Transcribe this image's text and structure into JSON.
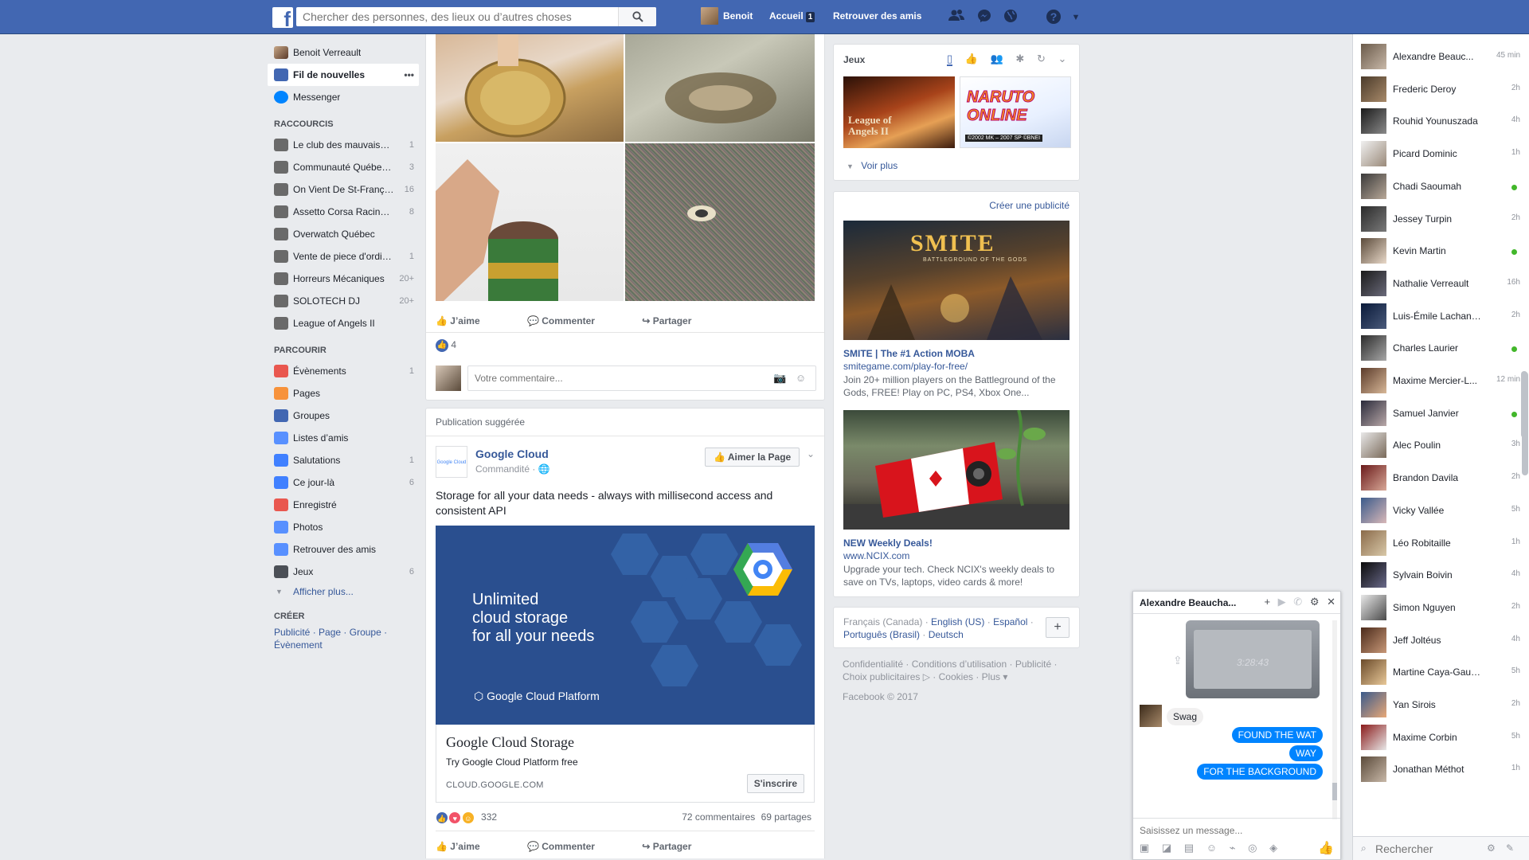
{
  "topbar": {
    "search_placeholder": "Chercher des personnes, des lieux ou d’autres choses",
    "user_name": "Benoit",
    "home": "Accueil",
    "home_badge": "1",
    "find_friends": "Retrouver des amis",
    "icons": [
      "friends-icon",
      "messenger-icon",
      "globe-icon",
      "help-icon"
    ]
  },
  "leftnav": {
    "profile": "Benoit Verreault",
    "main": [
      {
        "label": "Fil de nouvelles",
        "more": "•••",
        "color": "#4267b2"
      },
      {
        "label": "Messenger",
        "color": "#0084ff"
      }
    ],
    "shortcuts_head": "RACCOURCIS",
    "shortcuts": [
      {
        "label": "Le club des mauvais…",
        "count": "1",
        "icon": "skull-icon"
      },
      {
        "label": "Communauté Québe…",
        "count": "3",
        "icon": "gamepad-icon"
      },
      {
        "label": "On Vient De St-Franç…",
        "count": "16",
        "icon": "group-icon"
      },
      {
        "label": "Assetto Corsa Racin…",
        "count": "8",
        "icon": "gamepad-icon"
      },
      {
        "label": "Overwatch Québec",
        "count": "",
        "icon": "gamepad-icon"
      },
      {
        "label": "Vente de piece d'ordi…",
        "count": "1",
        "icon": "group-icon"
      },
      {
        "label": "Horreurs Mécaniques",
        "count": "20+",
        "icon": "skull-icon"
      },
      {
        "label": "SOLOTECH DJ",
        "count": "20+",
        "icon": "music-icon"
      },
      {
        "label": "League of Angels II",
        "count": "",
        "icon": "game-icon"
      }
    ],
    "explore_head": "PARCOURIR",
    "explore": [
      {
        "label": "Évènements",
        "count": "1",
        "icon": "calendar-icon",
        "color": "#e9574f"
      },
      {
        "label": "Pages",
        "count": "",
        "icon": "flag-icon",
        "color": "#f7923b"
      },
      {
        "label": "Groupes",
        "count": "",
        "icon": "groups-icon",
        "color": "#4267b2"
      },
      {
        "label": "Listes d’amis",
        "count": "",
        "icon": "friend-list-icon",
        "color": "#5890ff"
      },
      {
        "label": "Salutations",
        "count": "1",
        "icon": "poke-icon",
        "color": "#4080ff"
      },
      {
        "label": "Ce jour-là",
        "count": "6",
        "icon": "clock-icon",
        "color": "#4080ff"
      },
      {
        "label": "Enregistré",
        "count": "",
        "icon": "bookmark-icon",
        "color": "#e9574f"
      },
      {
        "label": "Photos",
        "count": "",
        "icon": "photos-icon",
        "color": "#5890ff"
      },
      {
        "label": "Retrouver des amis",
        "count": "",
        "icon": "find-friends-icon",
        "color": "#5890ff"
      },
      {
        "label": "Jeux",
        "count": "6",
        "icon": "games-icon",
        "color": "#4b4f56"
      }
    ],
    "show_more": "Afficher plus...",
    "create_head": "CRÉER",
    "create_links": [
      "Publicité",
      "Page",
      "Groupe",
      "Évènement"
    ]
  },
  "post1": {
    "actions": [
      "J’aime",
      "Commenter",
      "Partager"
    ],
    "likes": "4",
    "comment_placeholder": "Votre commentaire..."
  },
  "post2": {
    "suggested": "Publication suggérée",
    "page_name": "Google Cloud",
    "sponsored": "Commandité",
    "like_page": "Aimer la Page",
    "text": "Storage for all your data needs - always with millisecond access and consistent API",
    "ad_tagline": [
      "Unlimited",
      "cloud storage",
      "for all your needs"
    ],
    "ad_brand": "Google Cloud Platform",
    "ad_title": "Google Cloud Storage",
    "ad_desc": "Try Google Cloud Platform free",
    "ad_domain": "CLOUD.GOOGLE.COM",
    "signup": "S'inscrire",
    "reactions_count": "332",
    "comments": "72 commentaires",
    "shares": "69 partages",
    "actions": [
      "J’aime",
      "Commenter",
      "Partager"
    ]
  },
  "games": {
    "title": "Jeux",
    "tab_icons": [
      "bookmark-icon",
      "thumb-icon",
      "friends-icon",
      "badge-icon",
      "refresh-icon",
      "chevron-down-icon"
    ],
    "game1": "League of Angels II",
    "game2": "NARUTO ONLINE",
    "game2_sub": "©2002 MK – 2007 SP   ©BNEI",
    "see_more": "Voir plus"
  },
  "ads": {
    "create": "Créer une publicité",
    "smite_logo": "SMITE",
    "smite_logo_sub": "BATTLEGROUND OF THE GODS",
    "ad1_title": "SMITE | The #1 Action MOBA",
    "ad1_url": "smitegame.com/play-for-free/",
    "ad1_body": "Join 20+ million players on the Battleground of the Gods, FREE! Play on PC, PS4, Xbox One...",
    "ad2_title": "NEW Weekly Deals!",
    "ad2_url": "www.NCIX.com",
    "ad2_body": "Upgrade your tech. Check NCIX's weekly deals to save on TVs, laptops, video cards & more!"
  },
  "languages": {
    "current": "Français (Canada)",
    "others": [
      "English (US)",
      "Español",
      "Português (Brasil)",
      "Deutsch"
    ]
  },
  "footer": {
    "links": [
      "Confidentialité",
      "Conditions d’utilisation",
      "Publicité",
      "Choix publicitaires",
      "Cookies",
      "Plus"
    ],
    "copyright": "Facebook © 2017"
  },
  "contacts": [
    {
      "name": "Alexandre Beauc...",
      "time": "45 min",
      "online": false,
      "c1": "#6a5a4a",
      "c2": "#c8b8a8"
    },
    {
      "name": "Frederic Deroy",
      "time": "2h",
      "online": false,
      "c1": "#4a3a2a",
      "c2": "#a88a6a"
    },
    {
      "name": "Rouhid Younuszada",
      "time": "4h",
      "online": false,
      "c1": "#1a1a1a",
      "c2": "#8a8a8a"
    },
    {
      "name": "Picard Dominic",
      "time": "1h",
      "online": false,
      "c1": "#f0f0f0",
      "c2": "#9a8a7a"
    },
    {
      "name": "Chadi Saoumah",
      "time": "",
      "online": true,
      "c1": "#3a3a3a",
      "c2": "#b8a898"
    },
    {
      "name": "Jessey Turpin",
      "time": "2h",
      "online": false,
      "c1": "#2a2a2a",
      "c2": "#7a7a7a"
    },
    {
      "name": "Kevin Martin",
      "time": "",
      "online": true,
      "c1": "#5a4a3a",
      "c2": "#e8d8c8"
    },
    {
      "name": "Nathalie Verreault",
      "time": "16h",
      "online": false,
      "c1": "#1a1a1a",
      "c2": "#6a6a7a"
    },
    {
      "name": "Luis-Émile Lachance...",
      "time": "2h",
      "online": false,
      "c1": "#0a1a3a",
      "c2": "#4a5a7a"
    },
    {
      "name": "Charles Laurier",
      "time": "",
      "online": true,
      "c1": "#2a2a2a",
      "c2": "#a8a8a8"
    },
    {
      "name": "Maxime Mercier-L...",
      "time": "12 min",
      "online": false,
      "c1": "#5a3a2a",
      "c2": "#d8b898"
    },
    {
      "name": "Samuel Janvier",
      "time": "",
      "online": true,
      "c1": "#2a2a3a",
      "c2": "#b8a8a8"
    },
    {
      "name": "Alec Poulin",
      "time": "3h",
      "online": false,
      "c1": "#e8e8e8",
      "c2": "#7a6a5a"
    },
    {
      "name": "Brandon Davila",
      "time": "2h",
      "online": false,
      "c1": "#6a1a1a",
      "c2": "#d8a898"
    },
    {
      "name": "Vicky Vallée",
      "time": "5h",
      "online": false,
      "c1": "#3a5a8a",
      "c2": "#d8b8b8"
    },
    {
      "name": "Léo Robitaille",
      "time": "1h",
      "online": false,
      "c1": "#8a6a4a",
      "c2": "#d8c8a8"
    },
    {
      "name": "Sylvain Boivin",
      "time": "4h",
      "online": false,
      "c1": "#0a0a0a",
      "c2": "#6a6a8a"
    },
    {
      "name": "Simon Nguyen",
      "time": "2h",
      "online": false,
      "c1": "#e8e8e8",
      "c2": "#4a4a4a"
    },
    {
      "name": "Jeff Joltéus",
      "time": "4h",
      "online": false,
      "c1": "#4a2a1a",
      "c2": "#c89878"
    },
    {
      "name": "Martine Caya-Gaudron",
      "time": "5h",
      "online": false,
      "c1": "#6a4a2a",
      "c2": "#e8c898"
    },
    {
      "name": "Yan Sirois",
      "time": "2h",
      "online": false,
      "c1": "#3a5a8a",
      "c2": "#e8a878"
    },
    {
      "name": "Maxime Corbin",
      "time": "5h",
      "online": false,
      "c1": "#8a1a1a",
      "c2": "#e8e8e8"
    },
    {
      "name": "Jonathan Méthot",
      "time": "1h",
      "online": false,
      "c1": "#5a4a3a",
      "c2": "#c8b8a8"
    }
  ],
  "chat_sidebar": {
    "search_placeholder": "Rechercher"
  },
  "chat_window": {
    "name": "Alexandre Beaucha...",
    "video_time": "3:28:43",
    "incoming": "Swag",
    "outgoing": [
      "FOUND THE WAT",
      "WAY",
      "FOR THE BACKGROUND"
    ],
    "input_placeholder": "Saisissez un message..."
  }
}
